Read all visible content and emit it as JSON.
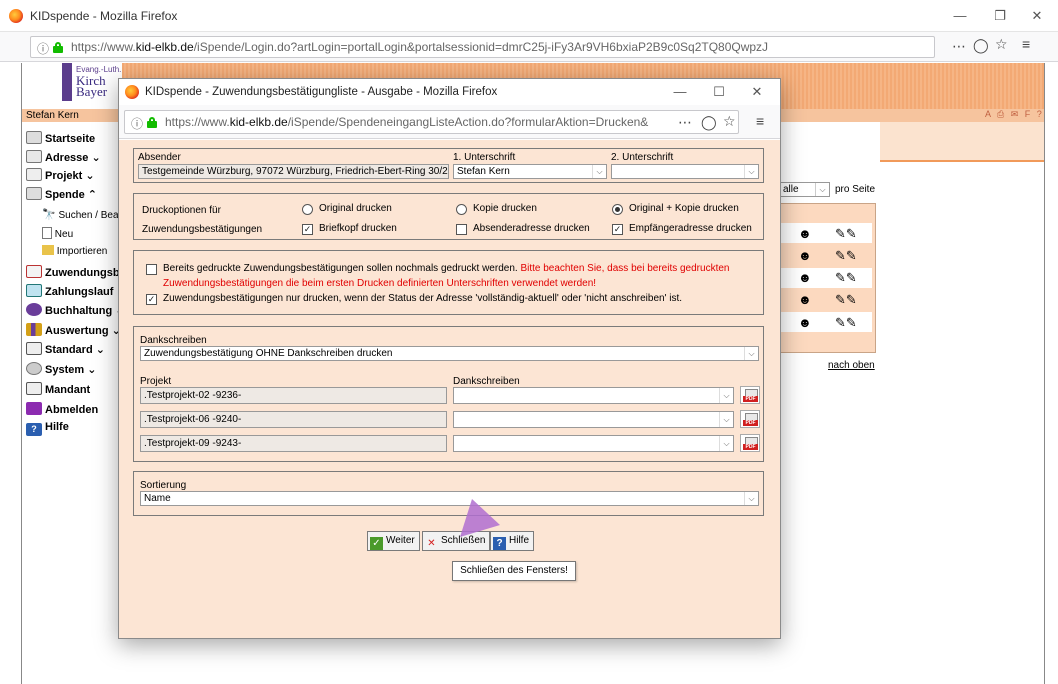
{
  "main_window": {
    "title": "KIDspende - Mozilla Firefox",
    "url_prefix": "https://www.",
    "url_domain": "kid-elkb.de",
    "url_path": "/iSpende/Login.do?artLogin=portalLogin&portalsessionid=dmrC25j-iFy3Ar9VH6bxiaP2B9c0Sq2TQ80QwpzJ"
  },
  "page": {
    "logo_line1": "Evang.-Luth.",
    "logo_line2": "Kirch",
    "logo_line3": "Bayer",
    "user": "Stefan Kern",
    "nav": [
      {
        "label": "Startseite"
      },
      {
        "label": "Adresse"
      },
      {
        "label": "Projekt"
      },
      {
        "label": "Spende"
      },
      {
        "label": "Suchen / Bearb"
      },
      {
        "label": "Neu"
      },
      {
        "label": "Importieren"
      },
      {
        "label": "Zuwendungsbe"
      },
      {
        "label": "Zahlungslauf"
      },
      {
        "label": "Buchhaltung"
      },
      {
        "label": "Auswertung"
      },
      {
        "label": "Standard"
      },
      {
        "label": "System"
      },
      {
        "label": "Mandant"
      },
      {
        "label": "Abmelden"
      },
      {
        "label": "Hilfe"
      }
    ],
    "per_page_value": "alle",
    "per_page_label": "pro Seite",
    "back_to_top": "nach oben"
  },
  "popup": {
    "title": "KIDspende - Zuwendungsbestätigungliste - Ausgabe - Mozilla Firefox",
    "url_prefix": "https://www.",
    "url_domain": "kid-elkb.de",
    "url_path": "/iSpende/SpendeneingangListeAction.do?formularAktion=Drucken&",
    "absender_label": "Absender",
    "absender_value": "Testgemeinde Würzburg, 97072 Würzburg, Friedrich-Ebert-Ring 30/2",
    "unterschrift1_label": "1. Unterschrift",
    "unterschrift1_value": "Stefan Kern",
    "unterschrift2_label": "2. Unterschrift",
    "unterschrift2_value": "",
    "druckoptionen_label1": "Druckoptionen für",
    "druckoptionen_label2": "Zuwendungsbestätigungen",
    "radio_original": "Original drucken",
    "radio_kopie": "Kopie drucken",
    "radio_both": "Original + Kopie drucken",
    "cb_briefkopf": "Briefkopf drucken",
    "cb_absender": "Absenderadresse drucken",
    "cb_empfaenger": "Empfängeradresse drucken",
    "cb_bereits": "Bereits gedruckte Zuwendungsbestätigungen sollen nochmals gedruckt werden.",
    "warning_1": "Bitte beachten Sie, dass bei bereits gedruckten",
    "warning_2": "Zuwendungsbestätigungen die beim ersten Drucken definierten Unterschriften verwendet werden!",
    "cb_status": "Zuwendungsbestätigungen nur drucken, wenn der Status der Adresse 'vollständig-aktuell' oder 'nicht anschreiben' ist.",
    "dankschreiben_label": "Dankschreiben",
    "dankschreiben_value": "Zuwendungsbestätigung OHNE Dankschreiben drucken",
    "projekt_label": "Projekt",
    "projekt_dank_label": "Dankschreiben",
    "projects": [
      {
        "name": ".Testprojekt-02 -9236-",
        "dank": ""
      },
      {
        "name": ".Testprojekt-06 -9240-",
        "dank": ""
      },
      {
        "name": ".Testprojekt-09 -9243-",
        "dank": ""
      }
    ],
    "sortierung_label": "Sortierung",
    "sortierung_value": "Name",
    "btn_weiter": "Weiter",
    "btn_schliessen": "Schließen",
    "btn_hilfe": "Hilfe",
    "tooltip": "Schließen des Fensters!"
  },
  "colors": {
    "popup_bg": "#fce5d4",
    "header_orange": "#f3a974",
    "warning_red": "#e00000",
    "lock_green": "#12bc00"
  }
}
